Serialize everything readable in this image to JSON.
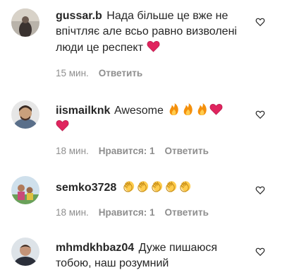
{
  "comments": [
    {
      "username": "gussar.b",
      "text": "Нада більше це вже не впічтляє але всьо равно визволені люди це респект",
      "emojis": [
        "red-heart"
      ],
      "time": "15 мин.",
      "likes": "",
      "reply_label": "Ответить"
    },
    {
      "username": "iismailknk",
      "text": "Awesome",
      "emojis": [
        "fire",
        "fire",
        "fire",
        "red-heart",
        "red-heart"
      ],
      "time": "18 мин.",
      "likes": "Нравится: 1",
      "reply_label": "Ответить"
    },
    {
      "username": "semko3728",
      "text": "",
      "emojis": [
        "clapping-hands",
        "clapping-hands",
        "clapping-hands",
        "clapping-hands",
        "clapping-hands"
      ],
      "time": "18 мин.",
      "likes": "Нравится: 1",
      "reply_label": "Ответить"
    },
    {
      "username": "mhmdkhbaz04",
      "text": "Дуже пишаюся тобою, наш розумний",
      "emojis": [],
      "time": "",
      "likes": "",
      "reply_label": ""
    }
  ],
  "colors": {
    "text": "#262626",
    "meta": "#8e8e8e",
    "heart": "#e0245e"
  }
}
